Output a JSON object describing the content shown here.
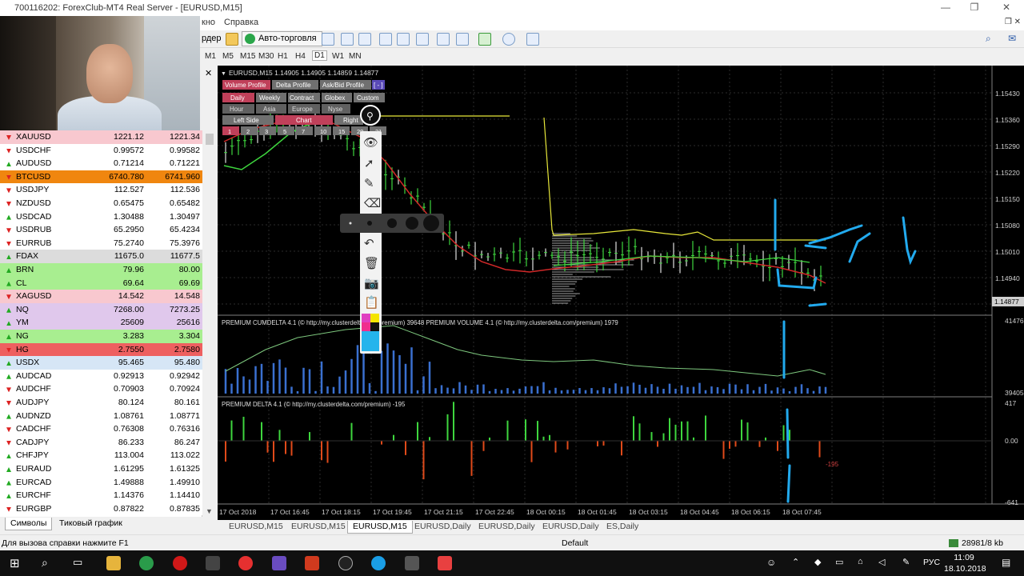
{
  "window": {
    "title": "700116202: ForexClub-MT4 Real Server - [EURUSD,M15]"
  },
  "menu": {
    "items": [
      "кно",
      "Справка"
    ]
  },
  "toolbar": {
    "order_label": "рдер",
    "autotrade_label": "Авто-торговля"
  },
  "timeframes": [
    "M1",
    "M5",
    "M15",
    "M30",
    "H1",
    "H4",
    "D1",
    "W1",
    "MN"
  ],
  "timeframe_selected": "D1",
  "market_watch": {
    "rows": [
      {
        "symbol": "XAUUSD",
        "bid": "1221.12",
        "ask": "1221.34",
        "dir": "down",
        "bg": "#f8c8cf"
      },
      {
        "symbol": "USDCHF",
        "bid": "0.99572",
        "ask": "0.99582",
        "dir": "down",
        "bg": "#ffffff"
      },
      {
        "symbol": "AUDUSD",
        "bid": "0.71214",
        "ask": "0.71221",
        "dir": "up",
        "bg": "#ffffff"
      },
      {
        "symbol": "BTCUSD",
        "bid": "6740.780",
        "ask": "6741.960",
        "dir": "down",
        "bg": "#f0860f"
      },
      {
        "symbol": "USDJPY",
        "bid": "112.527",
        "ask": "112.536",
        "dir": "down",
        "bg": "#ffffff"
      },
      {
        "symbol": "NZDUSD",
        "bid": "0.65475",
        "ask": "0.65482",
        "dir": "down",
        "bg": "#ffffff"
      },
      {
        "symbol": "USDCAD",
        "bid": "1.30488",
        "ask": "1.30497",
        "dir": "up",
        "bg": "#ffffff"
      },
      {
        "symbol": "USDRUB",
        "bid": "65.2950",
        "ask": "65.4234",
        "dir": "down",
        "bg": "#ffffff"
      },
      {
        "symbol": "EURRUB",
        "bid": "75.2740",
        "ask": "75.3976",
        "dir": "down",
        "bg": "#ffffff"
      },
      {
        "symbol": "FDAX",
        "bid": "11675.0",
        "ask": "11677.5",
        "dir": "up",
        "bg": "#dcdcdc"
      },
      {
        "symbol": "BRN",
        "bid": "79.96",
        "ask": "80.00",
        "dir": "up",
        "bg": "#a8ee90"
      },
      {
        "symbol": "CL",
        "bid": "69.64",
        "ask": "69.69",
        "dir": "up",
        "bg": "#a8ee90"
      },
      {
        "symbol": "XAGUSD",
        "bid": "14.542",
        "ask": "14.548",
        "dir": "down",
        "bg": "#f8c8cf"
      },
      {
        "symbol": "NQ",
        "bid": "7268.00",
        "ask": "7273.25",
        "dir": "up",
        "bg": "#e0c8ec"
      },
      {
        "symbol": "YM",
        "bid": "25609",
        "ask": "25616",
        "dir": "up",
        "bg": "#e0c8ec"
      },
      {
        "symbol": "NG",
        "bid": "3.283",
        "ask": "3.304",
        "dir": "up",
        "bg": "#a8ee90"
      },
      {
        "symbol": "HG",
        "bid": "2.7550",
        "ask": "2.7580",
        "dir": "down",
        "bg": "#ee6060"
      },
      {
        "symbol": "USDX",
        "bid": "95.465",
        "ask": "95.480",
        "dir": "up",
        "bg": "#d6e6f6"
      },
      {
        "symbol": "AUDCAD",
        "bid": "0.92913",
        "ask": "0.92942",
        "dir": "up",
        "bg": "#ffffff"
      },
      {
        "symbol": "AUDCHF",
        "bid": "0.70903",
        "ask": "0.70924",
        "dir": "down",
        "bg": "#ffffff"
      },
      {
        "symbol": "AUDJPY",
        "bid": "80.124",
        "ask": "80.161",
        "dir": "down",
        "bg": "#ffffff"
      },
      {
        "symbol": "AUDNZD",
        "bid": "1.08761",
        "ask": "1.08771",
        "dir": "up",
        "bg": "#ffffff"
      },
      {
        "symbol": "CADCHF",
        "bid": "0.76308",
        "ask": "0.76316",
        "dir": "down",
        "bg": "#ffffff"
      },
      {
        "symbol": "CADJPY",
        "bid": "86.233",
        "ask": "86.247",
        "dir": "down",
        "bg": "#ffffff"
      },
      {
        "symbol": "CHFJPY",
        "bid": "113.004",
        "ask": "113.022",
        "dir": "up",
        "bg": "#ffffff"
      },
      {
        "symbol": "EURAUD",
        "bid": "1.61295",
        "ask": "1.61325",
        "dir": "up",
        "bg": "#ffffff"
      },
      {
        "symbol": "EURCAD",
        "bid": "1.49888",
        "ask": "1.49910",
        "dir": "up",
        "bg": "#ffffff"
      },
      {
        "symbol": "EURCHF",
        "bid": "1.14376",
        "ask": "1.14410",
        "dir": "up",
        "bg": "#ffffff"
      },
      {
        "symbol": "EURGBP",
        "bid": "0.87822",
        "ask": "0.87835",
        "dir": "down",
        "bg": "#ffffff"
      }
    ],
    "tabs": [
      "Символы",
      "Тиковый график"
    ]
  },
  "chart": {
    "header": "EURUSD,M15 1.14905 1.14905 1.14859 1.14877",
    "price_labels": [
      "1.15430",
      "1.15360",
      "1.15290",
      "1.15220",
      "1.15150",
      "1.15080",
      "1.15010",
      "1.14940",
      "1.14877"
    ],
    "profile_tabs": [
      "Volume Profile",
      "Delta Profile",
      "Ask/Bid Profile",
      "[ - ]"
    ],
    "period_tabs": [
      "Daily",
      "Weekly",
      "Contract",
      "Globex",
      "Custom"
    ],
    "session_tabs": [
      "Hour",
      "Asia",
      "Europe",
      "Nyse"
    ],
    "side_tabs": [
      "Left Side",
      "Chart",
      "Right"
    ],
    "step_tabs": [
      "1",
      "2",
      "3",
      "5",
      "7",
      "10",
      "15",
      "20",
      "31"
    ],
    "sub1_header": "PREMIUM CUMDELTA 4.1 (© http://my.clusterdelta.com/premium) 39648  PREMIUM VOLUME 4.1 (© http://my.clusterdelta.com/premium) 1979",
    "sub1_scale": [
      "41476",
      "39405"
    ],
    "sub2_header": "PREMIUM DELTA 4.1 (© http://my.clusterdelta.com/premium) -195",
    "sub2_scale": [
      "417",
      "0.00",
      "-641"
    ],
    "sub2_marker": "-195",
    "time_labels": [
      "17 Oct 2018",
      "17 Oct 16:45",
      "17 Oct 18:15",
      "17 Oct 19:45",
      "17 Oct 21:15",
      "17 Oct 22:45",
      "18 Oct 00:15",
      "18 Oct 01:45",
      "18 Oct 03:15",
      "18 Oct 04:45",
      "18 Oct 06:15",
      "18 Oct 07:45"
    ],
    "tabs": [
      "EURUSD,M15",
      "EURUSD,M15",
      "EURUSD,M15",
      "EURUSD,Daily",
      "EURUSD,Daily",
      "EURUSD,Daily",
      "ES,Daily"
    ],
    "selected_tab": 2
  },
  "status": {
    "help": "Для вызова справки нажмите F1",
    "profile": "Default",
    "traffic": "28981/8 kb"
  },
  "taskbar": {
    "lang": "РУС",
    "time": "11:09",
    "date": "18.10.2018"
  }
}
